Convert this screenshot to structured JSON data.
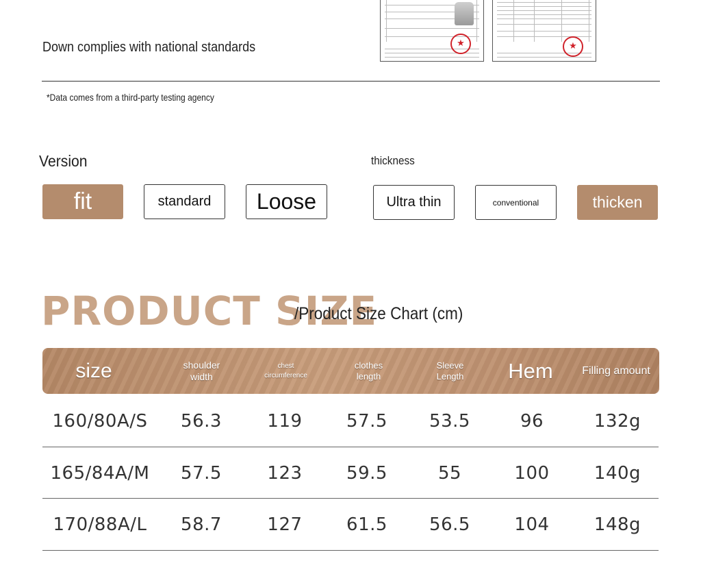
{
  "standards": {
    "statement": "Down complies with national standards",
    "note": "*Data comes from a third-party testing agency"
  },
  "version": {
    "label": "Version",
    "options": [
      {
        "label": "fit",
        "selected": true
      },
      {
        "label": "standard",
        "selected": false
      },
      {
        "label": "Loose",
        "selected": false
      }
    ]
  },
  "thickness": {
    "label": "thickness",
    "options": [
      {
        "label": "Ultra thin",
        "selected": false
      },
      {
        "label": "conventional",
        "selected": false
      },
      {
        "label": "thicken",
        "selected": true
      }
    ]
  },
  "size_section": {
    "title": "PRODUCT SIZE",
    "subtitle": "/Product Size Chart (cm)"
  },
  "size_table": {
    "headers": [
      {
        "line1": "size",
        "line2": ""
      },
      {
        "line1": "shoulder",
        "line2": "width"
      },
      {
        "line1": "chest",
        "line2": "circumference"
      },
      {
        "line1": "clothes",
        "line2": "length"
      },
      {
        "line1": "Sleeve",
        "line2": "Length"
      },
      {
        "line1": "Hem",
        "line2": ""
      },
      {
        "line1": "Filling amount",
        "line2": ""
      }
    ],
    "rows": [
      [
        "160/80A/S",
        "56.3",
        "119",
        "57.5",
        "53.5",
        "96",
        "132g"
      ],
      [
        "165/84A/M",
        "57.5",
        "123",
        "59.5",
        "55",
        "100",
        "140g"
      ],
      [
        "170/88A/L",
        "58.7",
        "127",
        "61.5",
        "56.5",
        "104",
        "148g"
      ]
    ]
  },
  "colors": {
    "accent": "#b48c6d",
    "title": "#c9a588"
  }
}
